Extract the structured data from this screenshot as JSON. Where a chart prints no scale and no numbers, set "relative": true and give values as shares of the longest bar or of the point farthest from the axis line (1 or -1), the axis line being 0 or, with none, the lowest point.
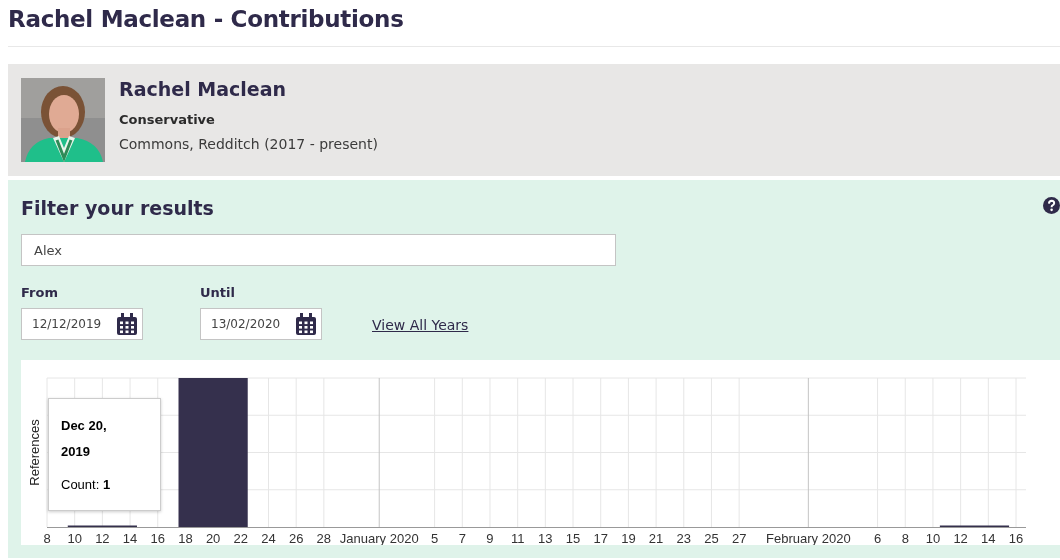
{
  "page_title": "Rachel Maclean - Contributions",
  "profile": {
    "name": "Rachel Maclean",
    "party": "Conservative",
    "seat": "Commons, Redditch (2017 - present)"
  },
  "filter": {
    "heading": "Filter your results",
    "search": {
      "value": "Alex"
    },
    "from": {
      "label": "From",
      "value": "12/12/2019"
    },
    "until": {
      "label": "Until",
      "value": "13/02/2020"
    },
    "link": "View All Years"
  },
  "chart": {
    "chart_data": {
      "type": "bar",
      "ylabel": "References",
      "x": [
        "2019-12-12",
        "2019-12-20",
        "2020-02-13"
      ],
      "values": [
        0,
        1,
        0
      ],
      "relative": true,
      "grid": true,
      "xlim": [
        "2019-12-08",
        "2020-02-16"
      ],
      "xticks": [
        {
          "value": "2019-12-08",
          "label": "8"
        },
        {
          "value": "2019-12-10",
          "label": "10"
        },
        {
          "value": "2019-12-12",
          "label": "12"
        },
        {
          "value": "2019-12-14",
          "label": "14"
        },
        {
          "value": "2019-12-16",
          "label": "16"
        },
        {
          "value": "2019-12-18",
          "label": "18"
        },
        {
          "value": "2019-12-20",
          "label": "20"
        },
        {
          "value": "2019-12-22",
          "label": "22"
        },
        {
          "value": "2019-12-24",
          "label": "24"
        },
        {
          "value": "2019-12-26",
          "label": "26"
        },
        {
          "value": "2019-12-28",
          "label": "28"
        },
        {
          "value": "2020-01-01",
          "label": "January 2020"
        },
        {
          "value": "2020-01-05",
          "label": "5"
        },
        {
          "value": "2020-01-07",
          "label": "7"
        },
        {
          "value": "2020-01-09",
          "label": "9"
        },
        {
          "value": "2020-01-11",
          "label": "11"
        },
        {
          "value": "2020-01-13",
          "label": "13"
        },
        {
          "value": "2020-01-15",
          "label": "15"
        },
        {
          "value": "2020-01-17",
          "label": "17"
        },
        {
          "value": "2020-01-19",
          "label": "19"
        },
        {
          "value": "2020-01-21",
          "label": "21"
        },
        {
          "value": "2020-01-23",
          "label": "23"
        },
        {
          "value": "2020-01-25",
          "label": "25"
        },
        {
          "value": "2020-01-27",
          "label": "27"
        },
        {
          "value": "2020-02-01",
          "label": "February 2020"
        },
        {
          "value": "2020-02-06",
          "label": "6"
        },
        {
          "value": "2020-02-08",
          "label": "8"
        },
        {
          "value": "2020-02-10",
          "label": "10"
        },
        {
          "value": "2020-02-12",
          "label": "12"
        },
        {
          "value": "2020-02-14",
          "label": "14"
        },
        {
          "value": "2020-02-16",
          "label": "16"
        }
      ]
    },
    "tooltip": {
      "title": "Dec 20, 2019",
      "text": "Count: **1**"
    }
  }
}
